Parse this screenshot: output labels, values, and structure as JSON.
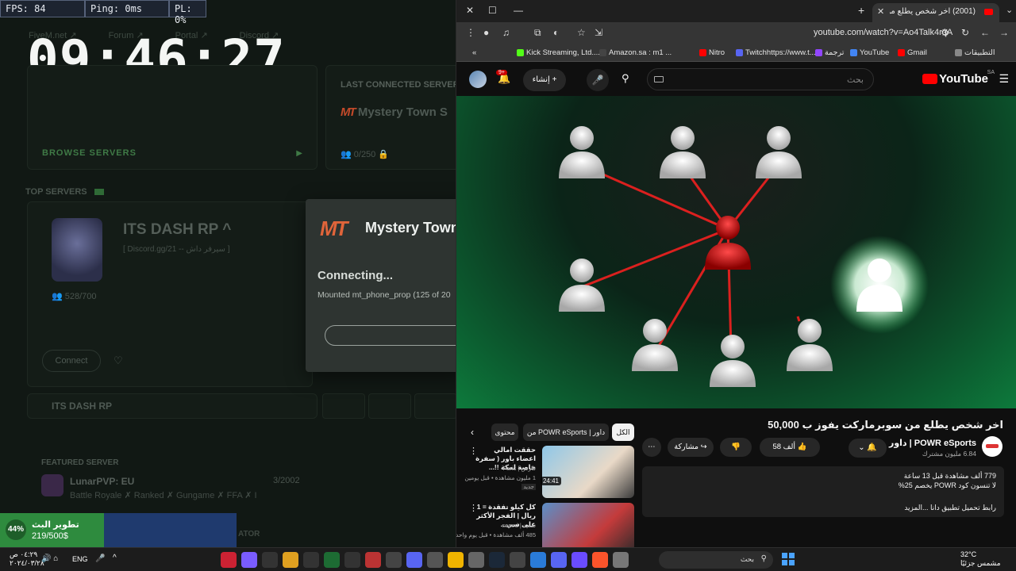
{
  "launcher": {
    "fps": "FPS: 84",
    "ping": "Ping: 0ms",
    "pl": "PL: 0%",
    "clock": "09:46:27",
    "nav": [
      "FiveM.net",
      "Forum",
      "Portal",
      "Discord"
    ],
    "browse_label": "BROWSE SERVERS",
    "last_connected_title": "LAST CONNECTED SERVER",
    "last_connected_logo": "MT",
    "last_connected_name": "Mystery Town S",
    "last_connected_players": "0/250",
    "top_servers_title": "TOP SERVERS",
    "top_server_name": "ITS DASH RP",
    "top_server_sub": "[ Discord.gg/21 -- سيرفر داش ]",
    "top_server_players": "528/700",
    "connect_label": "Connect",
    "row_server_name": "ITS DASH RP",
    "featured_title": "FEATURED SERVER",
    "featured_name": "LunarPVP: EU",
    "featured_desc": "Battle Royale ✗ Ranked ✗ Gungame ✗ FFA ✗ I",
    "featured_players": "3/2002",
    "bottom_faint": "ATOR",
    "dialog": {
      "logo": "MT",
      "title": "Mystery Town",
      "status": "Connecting...",
      "detail": "Mounted mt_phone_prop (125 of 20"
    },
    "progress_widget": {
      "percent": "44%",
      "percent_value": 0.44,
      "name": "تطوير البث",
      "amount": "219/500$"
    }
  },
  "browser": {
    "tab_title": "(2001) اخر شخص يطلع من سو",
    "url": "youtube.com/watch?v=Ao4Talk4rqA",
    "bookmarks": [
      "التطبيقات",
      "Gmail",
      "YouTube",
      "ترجمة",
      "Twitchhttps://www.t...",
      "Nitro",
      "Amazon.sa : m1 ...",
      "Kick Streaming, Ltd...."
    ],
    "youtube": {
      "logo": "YouTube",
      "region": "SA",
      "search_placeholder": "بحث",
      "create_label": "إنشاء",
      "notif_badge": "9+",
      "video_title": "اخر شخص يطلع من سوبرماركت يفوز ب 50,000",
      "channel_name": "POWR eSports | داور",
      "channel_subs": "6.84 مليون مشترك",
      "likes": "58 ألف",
      "share_label": "مشاركة",
      "description": {
        "line1": "779 ألف مشاهدة  قبل 13 ساعة",
        "line2": "لا تنسون كود POWR يخصم 25%",
        "line3": "رابط تحميل تطبيق دانا ...المزيد"
      },
      "chips": [
        "الكل",
        "من POWR eSports | داور",
        "محتوى"
      ],
      "recommendations": [
        {
          "title": "حققت امالي اعضاء باور ( سفرة خاصة لمكة !!...",
          "channel": "فارس | Faris",
          "meta": "1 مليون مشاهدة • قبل يومين",
          "badge": "جديد",
          "duration": "24:41"
        },
        {
          "title": "كل كيلو تفقدة = 1 ريال | الفجر الأكثر على سي...",
          "channel": "سعيد | saeed",
          "meta": "485 ألف مشاهدة • قبل يوم واحد",
          "badge": "",
          "duration": ""
        }
      ]
    }
  },
  "taskbar": {
    "time": "٠٤:٢٩ ص",
    "date": "٢٠٢٤/٠٣/٢٨",
    "lang": "ENG",
    "search_placeholder": "بحث",
    "weather_temp": "32°C",
    "weather_desc": "مشمس جزئيًا"
  },
  "colors": {
    "youtube_red": "#ff0000",
    "launcher_green": "#2e8b3e",
    "mt_orange": "#e0643a"
  }
}
